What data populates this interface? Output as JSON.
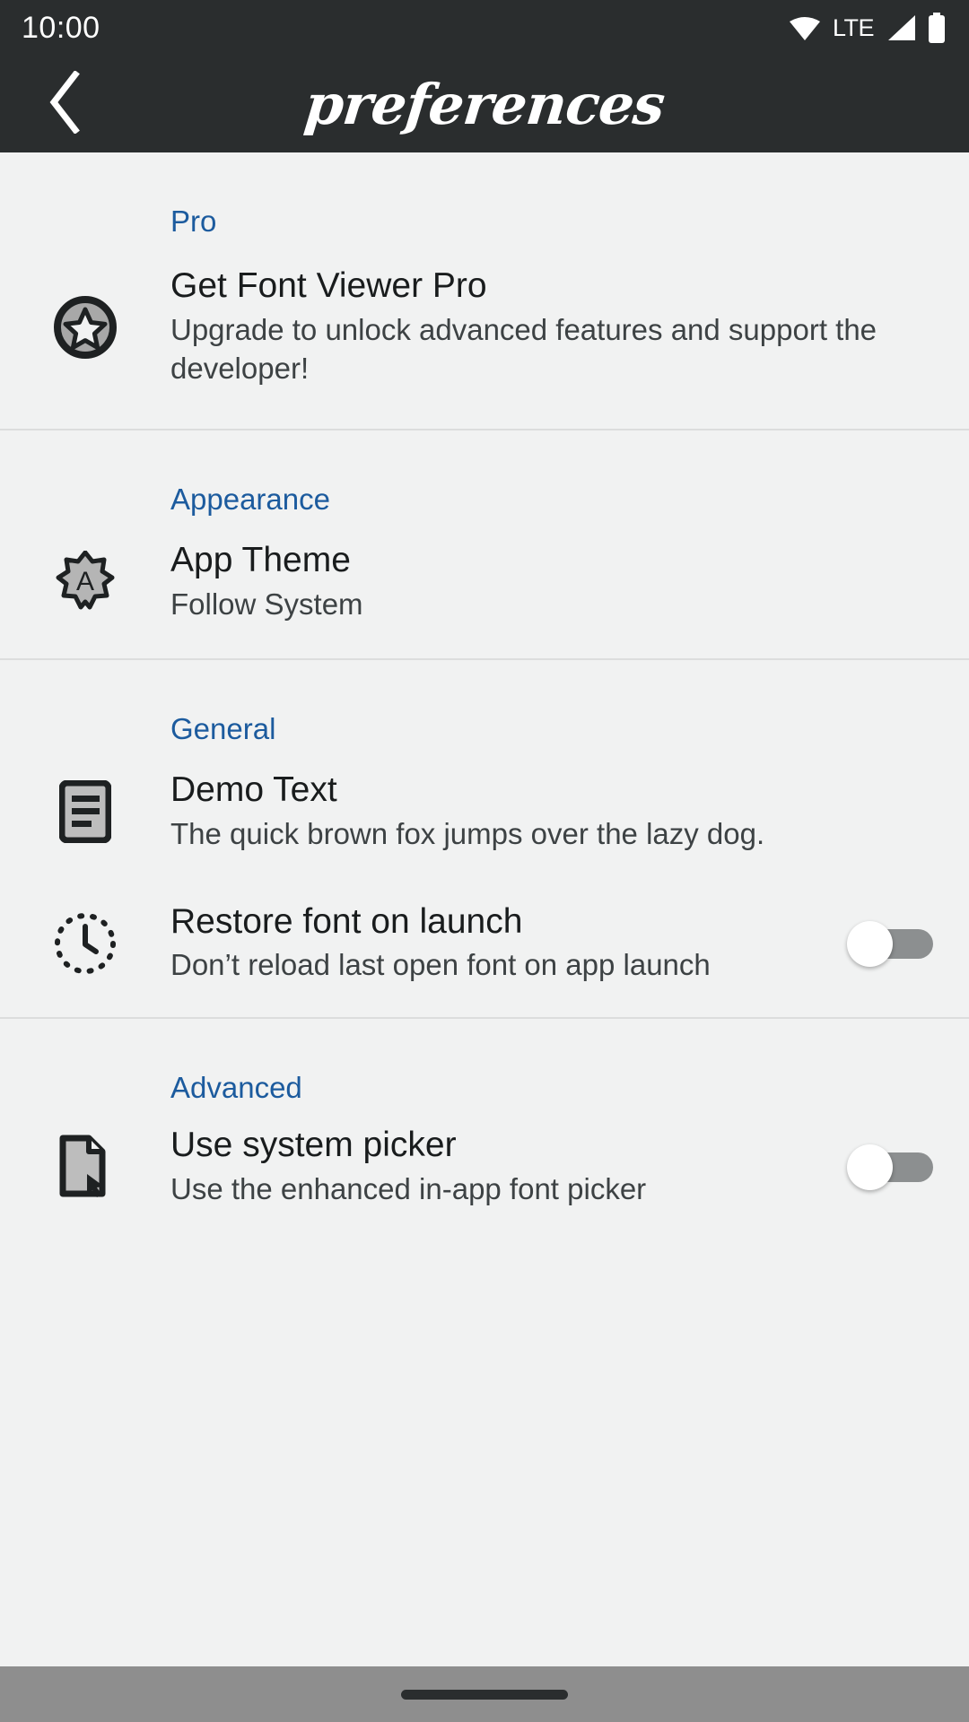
{
  "status_bar": {
    "clock": "10:00",
    "network_label": "LTE",
    "icons": [
      "wifi-icon",
      "signal-icon",
      "battery-icon"
    ]
  },
  "app_bar": {
    "title": "preferences",
    "back_icon": "chevron-left-icon"
  },
  "colors": {
    "accent": "#1c5b9e",
    "header_bg": "#2a2d2e",
    "page_bg": "#f1f2f2",
    "switch_track_off": "#8c8f90",
    "switch_thumb": "#ffffff",
    "nav_bar": "#8e8e8e"
  },
  "sections": [
    {
      "header": "Pro",
      "rows": [
        {
          "icon": "star-badge-icon",
          "title": "Get Font Viewer Pro",
          "subtitle": "Upgrade to unlock advanced features and support the developer!",
          "control": "none"
        }
      ]
    },
    {
      "header": "Appearance",
      "rows": [
        {
          "icon": "theme-badge-a-icon",
          "title": "App Theme",
          "subtitle": "Follow System",
          "control": "none"
        }
      ]
    },
    {
      "header": "General",
      "rows": [
        {
          "icon": "text-lines-icon",
          "title": "Demo Text",
          "subtitle": "The quick brown fox jumps over the lazy dog.",
          "control": "none"
        },
        {
          "icon": "clock-dashed-icon",
          "title": "Restore font on launch",
          "subtitle": "Don’t reload last open font on app launch",
          "control": "switch",
          "switch_on": false
        }
      ]
    },
    {
      "header": "Advanced",
      "rows": [
        {
          "icon": "file-cursor-icon",
          "title": "Use system picker",
          "subtitle": "Use the enhanced in-app font picker",
          "control": "switch",
          "switch_on": false
        }
      ]
    }
  ],
  "nav_bar": {
    "handle": "home-gesture-pill"
  }
}
